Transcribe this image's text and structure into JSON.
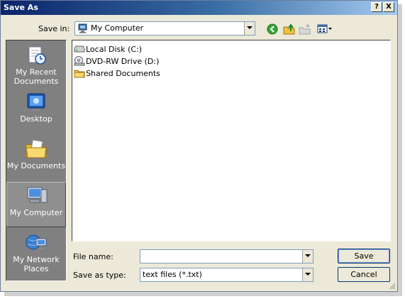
{
  "window": {
    "title": "Save As"
  },
  "titlebar": {
    "help_label": "?",
    "close_label": "X"
  },
  "toolbar": {
    "save_in_label": "Save in:",
    "save_in_value": "My Computer"
  },
  "places": [
    {
      "label": "My Recent Documents",
      "icon": "recent-documents-icon"
    },
    {
      "label": "Desktop",
      "icon": "desktop-icon"
    },
    {
      "label": "My Documents",
      "icon": "my-documents-icon"
    },
    {
      "label": "My Computer",
      "icon": "my-computer-icon",
      "selected": true
    },
    {
      "label": "My Network Places",
      "icon": "network-places-icon"
    }
  ],
  "files": [
    {
      "name": "Local Disk (C:)",
      "icon": "local-disk-icon"
    },
    {
      "name": "DVD-RW Drive (D:)",
      "icon": "dvd-drive-icon"
    },
    {
      "name": "Shared Documents",
      "icon": "folder-icon"
    }
  ],
  "form": {
    "file_name_label": "File name:",
    "file_name_value": "",
    "save_as_type_label": "Save as type:",
    "save_as_type_value": "text files (*.txt)"
  },
  "buttons": {
    "save": "Save",
    "cancel": "Cancel"
  },
  "colors": {
    "titlebar_start": "#0a246a",
    "titlebar_end": "#a6caf0",
    "dialog_bg": "#ece9d8",
    "places_bg": "#808080"
  }
}
